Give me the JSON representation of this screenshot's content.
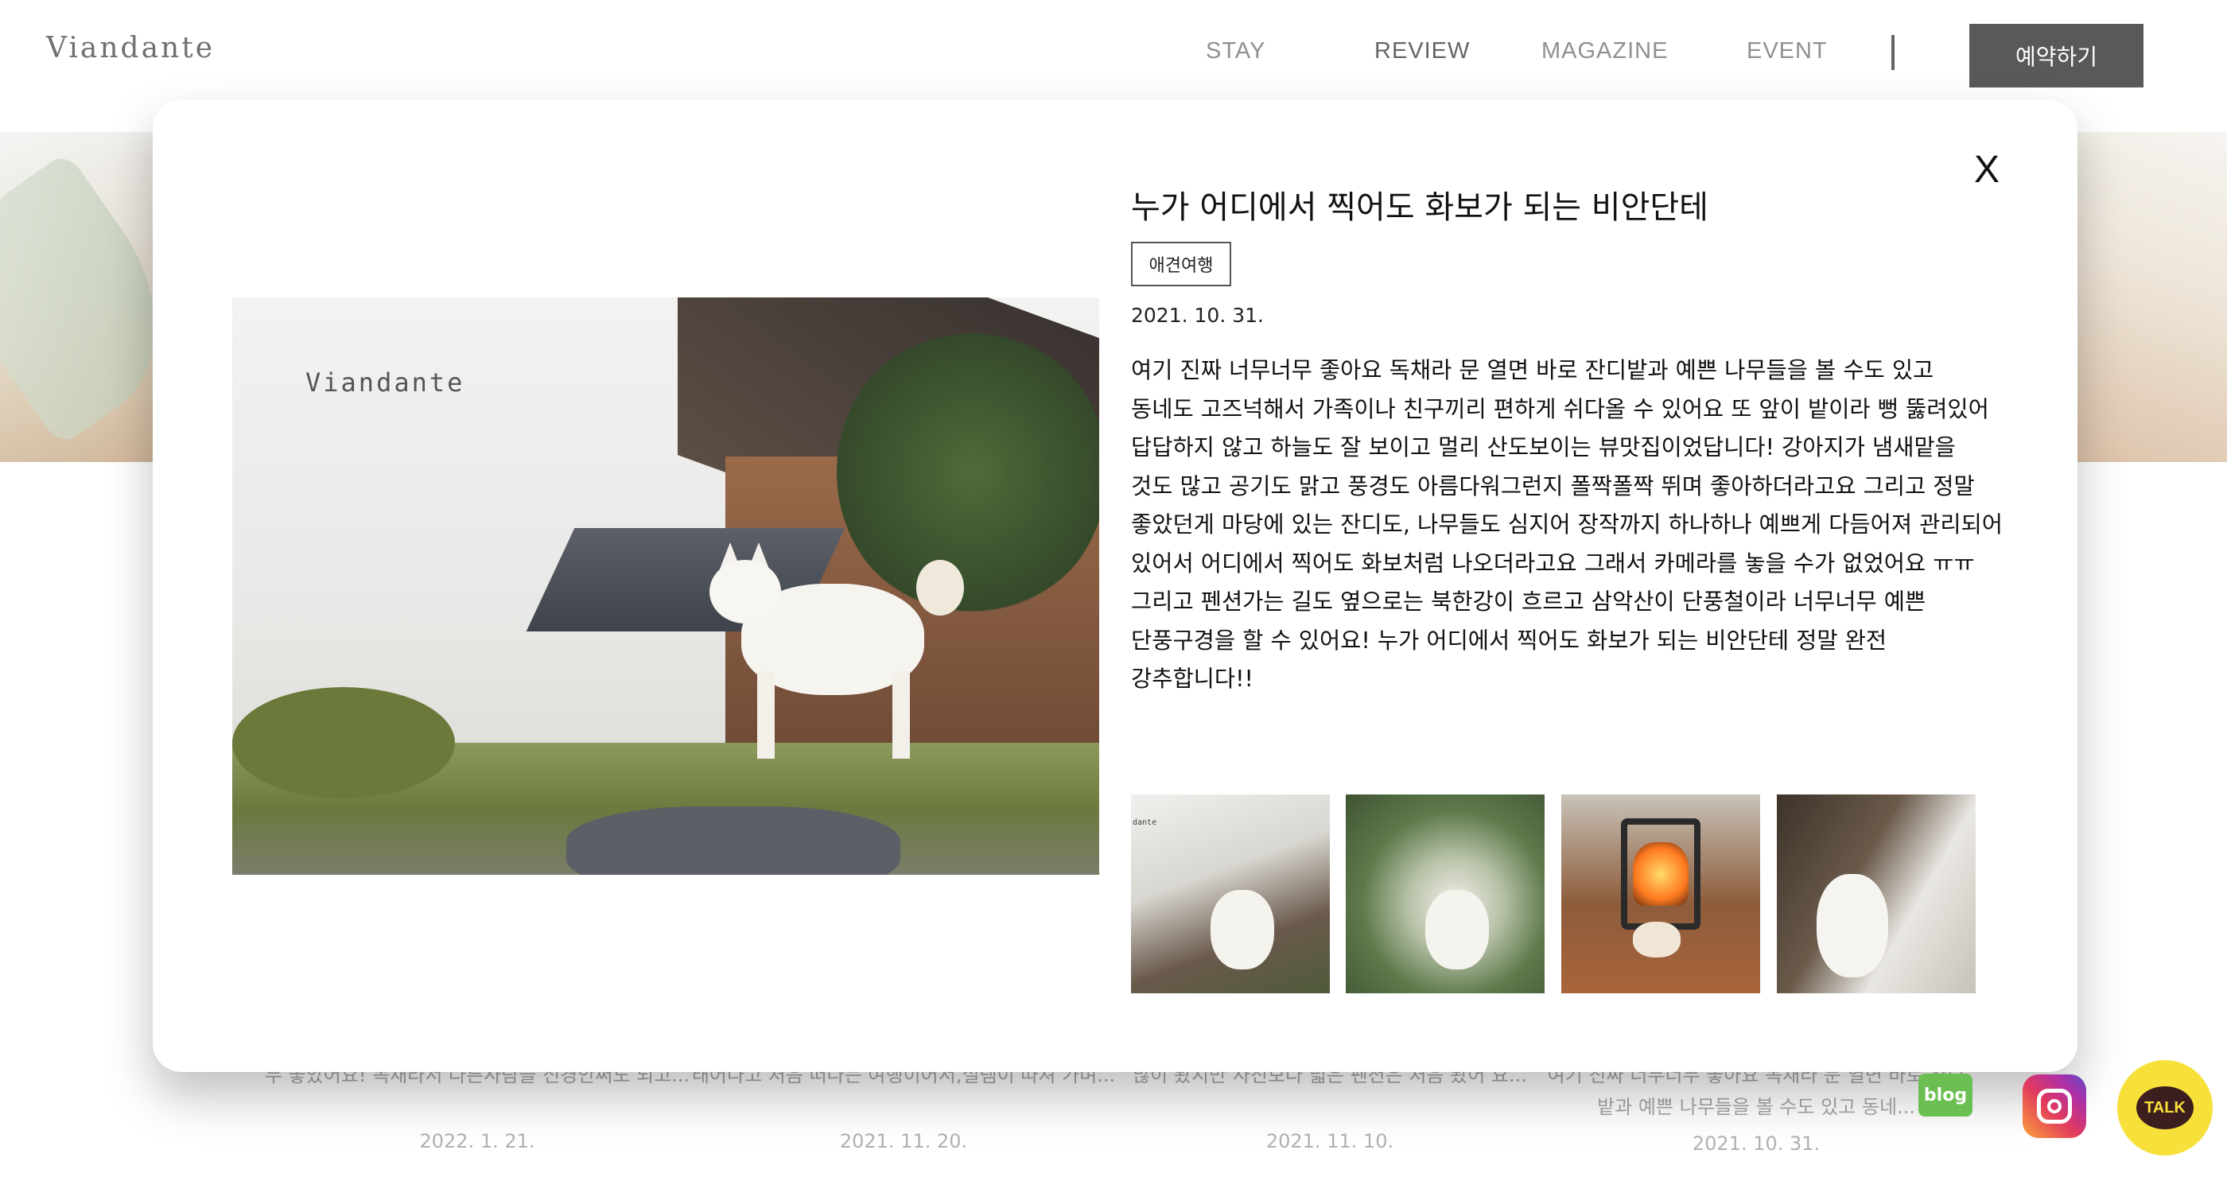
{
  "header": {
    "logo": "Viandante",
    "nav": [
      "STAY",
      "REVIEW",
      "MAGAZINE",
      "EVENT"
    ],
    "reserve_label": "예약하기"
  },
  "background_cards": [
    {
      "text": "무 좋았어요! 독채라서 다른사람을 신경안써도 되고...",
      "date": "2022. 1. 21."
    },
    {
      "text": "태어나고 처음 떠나는 여행이어서,설렘이 따져 가며...",
      "date": "2021. 11. 20."
    },
    {
      "text": "많이 봤지만 사진보다 넓은 펜션은 처음 봤어 요...",
      "date": "2021. 11. 10."
    },
    {
      "text": "여기 진짜 너무너무 좋아요 독채라 문 열면 바로 잔디밭과 예쁜 나무들을 볼 수도 있고 동네...",
      "date": "2021. 10. 31."
    }
  ],
  "modal": {
    "close_label": "X",
    "photo_watermark": "Viandante",
    "title": "누가 어디에서 찍어도 화보가 되는 비안단테",
    "tag": "애견여행",
    "date": "2021. 10. 31.",
    "body": "여기 진짜 너무너무 좋아요 독채라 문 열면 바로 잔디밭과 예쁜 나무들을 볼 수도 있고 동네도 고즈넉해서 가족이나 친구끼리 편하게 쉬다올 수 있어요 또 앞이 밭이라 뻥 뚫려있어 답답하지 않고 하늘도 잘 보이고 멀리 산도보이는 뷰맛집이었답니다! 강아지가 냄새맡을 것도 많고 공기도 맑고 풍경도 아름다워그런지 폴짝폴짝 뛰며 좋아하더라고요 그리고 정말 좋았던게 마당에 있는 잔디도, 나무들도 심지어 장작까지 하나하나 예쁘게 다듬어져 관리되어 있어서 어디에서 찍어도 화보처럼 나오더라고요 그래서 카메라를 놓을 수가 없었어요 ㅠㅠ 그리고 펜션가는 길도 옆으로는 북한강이 흐르고 삼악산이 단풍철이라 너무너무 예쁜 단풍구경을 할 수 있어요! 누가 어디에서 찍어도 화보가 되는 비안단테 정말 완전 강추합니다!!",
    "thumb_mark": "dante"
  },
  "social": {
    "blog_label": "blog",
    "kakao_label": "TALK"
  }
}
